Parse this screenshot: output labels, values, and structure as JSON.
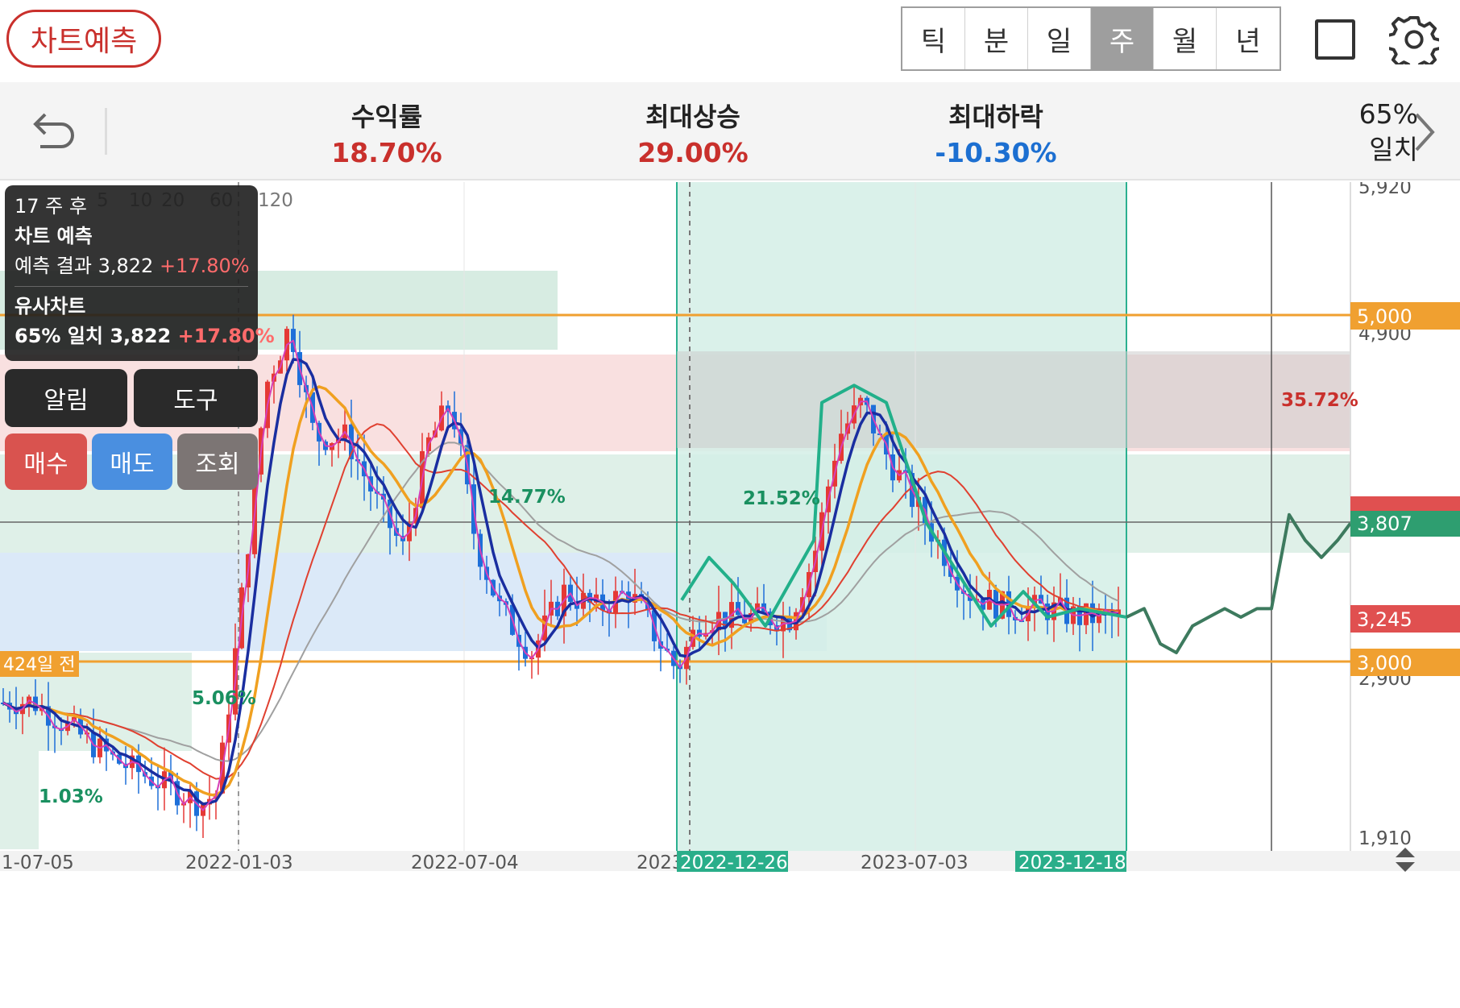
{
  "toolbar": {
    "predict_label": "차트예측",
    "periods": [
      "틱",
      "분",
      "일",
      "주",
      "월",
      "년"
    ],
    "active_period": "주"
  },
  "stats": {
    "return_label": "수익률",
    "return_value": "18.70%",
    "max_rise_label": "최대상승",
    "max_rise_value": "29.00%",
    "max_fall_label": "최대하락",
    "max_fall_value": "-10.30%",
    "match_pct": "65%",
    "match_label": "일치"
  },
  "info_panel": {
    "weeks_after": "17 주 후",
    "title": "차트 예측",
    "result_label": "예측 결과",
    "result_value": "3,822",
    "result_pct": "+17.80%",
    "similar_title": "유사차트",
    "similar_match": "65% 일치",
    "similar_value": "3,822",
    "similar_pct": "+17.80%"
  },
  "ma_legend": [
    "5",
    "10",
    "20",
    "60",
    "120"
  ],
  "buttons": {
    "alarm": "알림",
    "tool": "도구",
    "buy": "매수",
    "sell": "매도",
    "view": "조회"
  },
  "colors": {
    "up": "#e53935",
    "down": "#1e6fd9",
    "ma5": "#d63fb7",
    "ma10": "#1a2ea0",
    "ma20": "#f0a020",
    "ma60": "#e04030",
    "ma120": "#a0a0a0",
    "forecast": "#3d7a5e",
    "pattern": "#22b08a",
    "hline": "#f0a030"
  },
  "chart_data": {
    "type": "candlestick",
    "y_axis": {
      "ticks": [
        "5,920",
        "4,900",
        "2,900",
        "1,910"
      ],
      "tick_values": [
        5920,
        4900,
        2900,
        1910
      ]
    },
    "x_axis": {
      "labels": [
        "1-07-05",
        "2022-01-03",
        "2022-07-04",
        "2023",
        "2023-07-03"
      ],
      "highlight_labels": [
        "2022-12-26",
        "2023-12-18"
      ]
    },
    "price_tags": [
      {
        "label": "5,000",
        "value": 5000,
        "color": "#f0a030"
      },
      {
        "label": "3,807",
        "value": 3807,
        "color": "#2e9e70"
      },
      {
        "label": "3,245",
        "value": 3245,
        "color": "#e05050"
      },
      {
        "label": "3,000",
        "value": 3000,
        "color": "#f0a030"
      }
    ],
    "zone_labels": [
      {
        "text": "14.77%",
        "color": "#1a9060"
      },
      {
        "text": "35.72%",
        "color": "#c9302c"
      },
      {
        "text": "21.52%",
        "color": "#1a9060"
      },
      {
        "text": "5.06%",
        "color": "#1a9060"
      },
      {
        "text": "1.03%",
        "color": "#1a9060"
      },
      {
        "text": "424일 전",
        "color": "#fff"
      }
    ]
  }
}
